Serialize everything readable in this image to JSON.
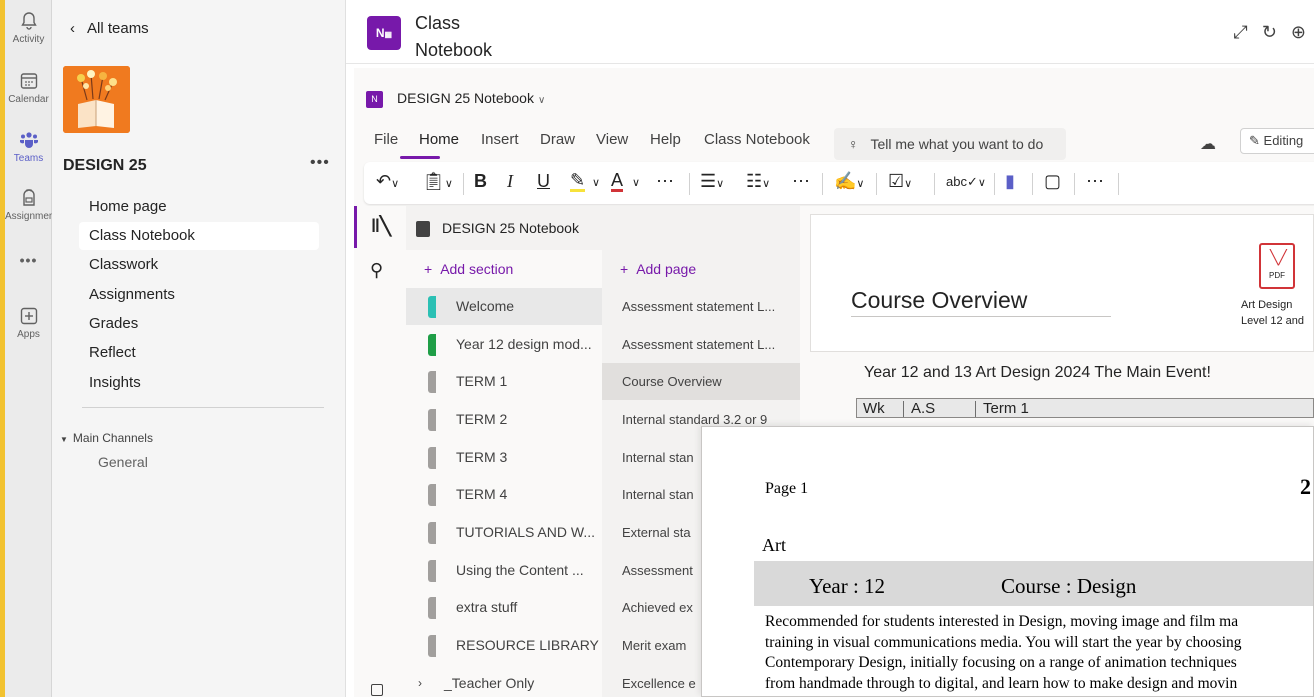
{
  "colors": {
    "accent": "#7719aa",
    "teams_accent": "#5b5fc7",
    "frame": "#7a1515",
    "highlight_bar": "#f2c230"
  },
  "rail": {
    "items": [
      {
        "label": "Activity",
        "icon": "bell-icon"
      },
      {
        "label": "Calendar",
        "icon": "calendar-icon"
      },
      {
        "label": "Teams",
        "icon": "teams-icon"
      },
      {
        "label": "Assignments",
        "icon": "backpack-icon"
      },
      {
        "label": "•••",
        "icon": "more-icon"
      },
      {
        "label": "Apps",
        "icon": "apps-icon"
      }
    ]
  },
  "sidebar": {
    "back_label": "All teams",
    "team_name": "DESIGN 25",
    "more": "•••",
    "nav": [
      {
        "label": "Home page"
      },
      {
        "label": "Class Notebook"
      },
      {
        "label": "Classwork"
      },
      {
        "label": "Assignments"
      },
      {
        "label": "Grades"
      },
      {
        "label": "Reflect"
      },
      {
        "label": "Insights"
      }
    ],
    "channels_header": "Main Channels",
    "channels": [
      "General"
    ]
  },
  "header": {
    "title_line1": "Class",
    "title_line2": "Notebook",
    "app_icon_text": "N"
  },
  "onenote": {
    "notebook_title": "DESIGN 25 Notebook",
    "menu_tabs": [
      "File",
      "Home",
      "Insert",
      "Draw",
      "View",
      "Help",
      "Class Notebook"
    ],
    "selected_tab": "Home",
    "tell_me": "Tell me what you want to do",
    "editing_label": "Editing",
    "notebook_row": "DESIGN 25 Notebook",
    "add_section": "Add section",
    "add_page": "Add page",
    "sections": [
      {
        "label": "Welcome",
        "color": "#2bc0b4"
      },
      {
        "label": "Year 12 design mod...",
        "color": "#1f9e47"
      },
      {
        "label": "TERM 1",
        "color": "#a19f9d"
      },
      {
        "label": "TERM 2",
        "color": "#a19f9d"
      },
      {
        "label": "TERM 3",
        "color": "#a19f9d"
      },
      {
        "label": "TERM 4",
        "color": "#a19f9d"
      },
      {
        "label": "TUTORIALS AND W...",
        "color": "#a19f9d"
      },
      {
        "label": "Using the Content ...",
        "color": "#a19f9d"
      },
      {
        "label": "extra stuff",
        "color": "#a19f9d"
      },
      {
        "label": "RESOURCE LIBRARY",
        "color": "#a19f9d"
      }
    ],
    "section_group": "_Teacher Only",
    "pages": [
      "Assessment statement L...",
      "Assessment statement L...",
      "Course Overview",
      "Internal standard 3.2 or 9",
      "Internal stan",
      "Internal stan",
      "External sta",
      "Assessment",
      "Achieved ex",
      "Merit exam",
      "Excellence e"
    ],
    "page_title": "Course Overview",
    "attachment_label_1": "Art Design",
    "attachment_label_2": "Level 12 and",
    "attachment_badge": "PDF",
    "event_heading": "Year 12 and 13 Art Design 2024 The Main Event!",
    "table_headers": [
      "Wk",
      "A.S",
      "Term 1"
    ]
  },
  "document": {
    "page_label": "Page 1",
    "page_number": "2",
    "subject": "Art",
    "year": "Year : 12",
    "course": "Course : Design",
    "body_lines": [
      "Recommended for students interested in Design, moving image and film ma",
      "training in visual communications media. You will start the year by choosing",
      "Contemporary Design, initially focusing on a range of animation techniques",
      "from handmade through to digital, and learn how to make design and movin"
    ]
  }
}
